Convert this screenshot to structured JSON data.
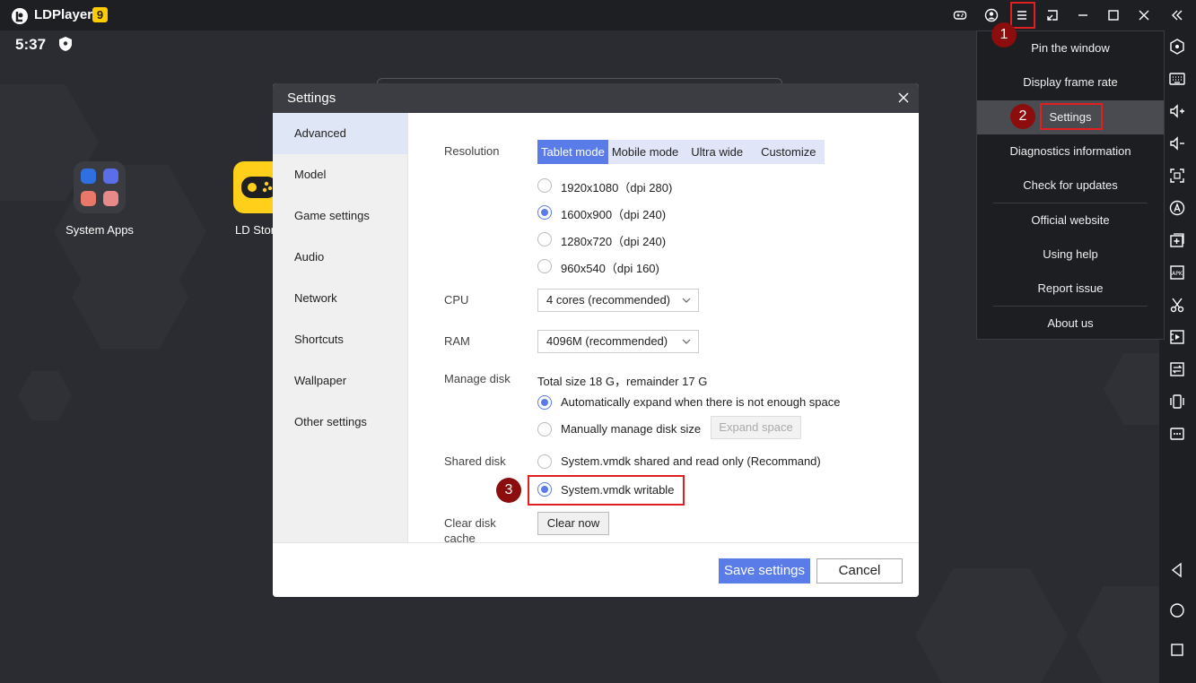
{
  "titlebar": {
    "app_name": "LDPlayer",
    "version": "9"
  },
  "status": {
    "time": "5:37"
  },
  "desktop": {
    "apps": [
      {
        "label": "System Apps"
      },
      {
        "label": "LD Stor"
      }
    ]
  },
  "menu": {
    "items": [
      {
        "label": "Pin the window"
      },
      {
        "label": "Display frame rate"
      },
      {
        "label": "Settings"
      },
      {
        "label": "Diagnostics information"
      },
      {
        "label": "Check for updates"
      },
      {
        "label": "Official website"
      },
      {
        "label": "Using help"
      },
      {
        "label": "Report issue"
      },
      {
        "label": "About us"
      }
    ]
  },
  "steps": [
    "1",
    "2",
    "3"
  ],
  "dialog": {
    "title": "Settings",
    "nav": [
      "Advanced",
      "Model",
      "Game settings",
      "Audio",
      "Network",
      "Shortcuts",
      "Wallpaper",
      "Other settings"
    ],
    "resolution": {
      "label": "Resolution",
      "modes": [
        "Tablet mode",
        "Mobile mode",
        "Ultra wide",
        "Customize"
      ],
      "selected_mode": "Tablet mode",
      "options": [
        "1920x1080（dpi 280)",
        "1600x900（dpi 240)",
        "1280x720（dpi 240)",
        "960x540（dpi 160)"
      ],
      "selected_option": "1600x900（dpi 240)"
    },
    "cpu": {
      "label": "CPU",
      "value": "4 cores (recommended)"
    },
    "ram": {
      "label": "RAM",
      "value": "4096M (recommended)"
    },
    "disk": {
      "label": "Manage disk",
      "total": "Total size 18 G，remainder 17 G",
      "auto_label": "Automatically expand when there is not enough space",
      "manual_label": "Manually manage disk size",
      "expand_button": "Expand space"
    },
    "shared": {
      "label": "Shared disk",
      "readonly_label": "System.vmdk shared and read only (Recommand)",
      "writable_label": "System.vmdk writable"
    },
    "cache": {
      "label": "Clear disk cache",
      "button": "Clear now"
    },
    "save_button": "Save settings",
    "cancel_button": "Cancel"
  },
  "colors": {
    "accent": "#5a7ce8",
    "highlight": "#e02020",
    "step_badge": "#8b0d0d"
  }
}
